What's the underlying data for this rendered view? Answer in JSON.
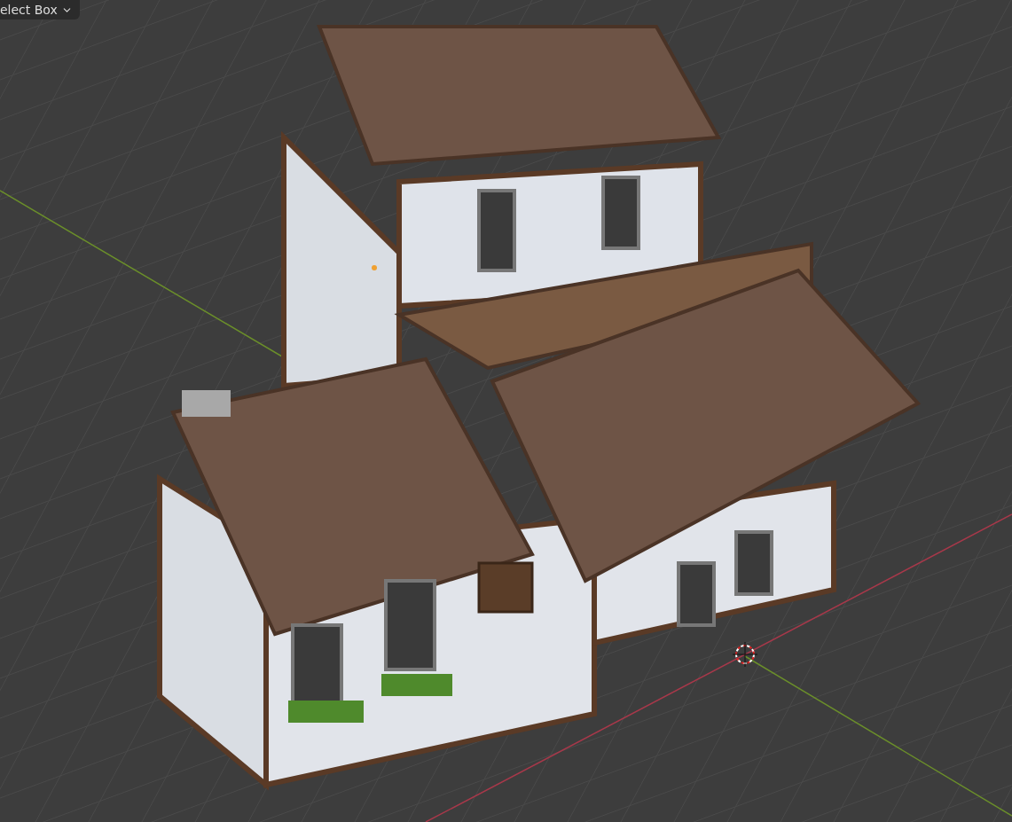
{
  "header": {
    "select_mode": {
      "label": "elect Box"
    }
  }
}
